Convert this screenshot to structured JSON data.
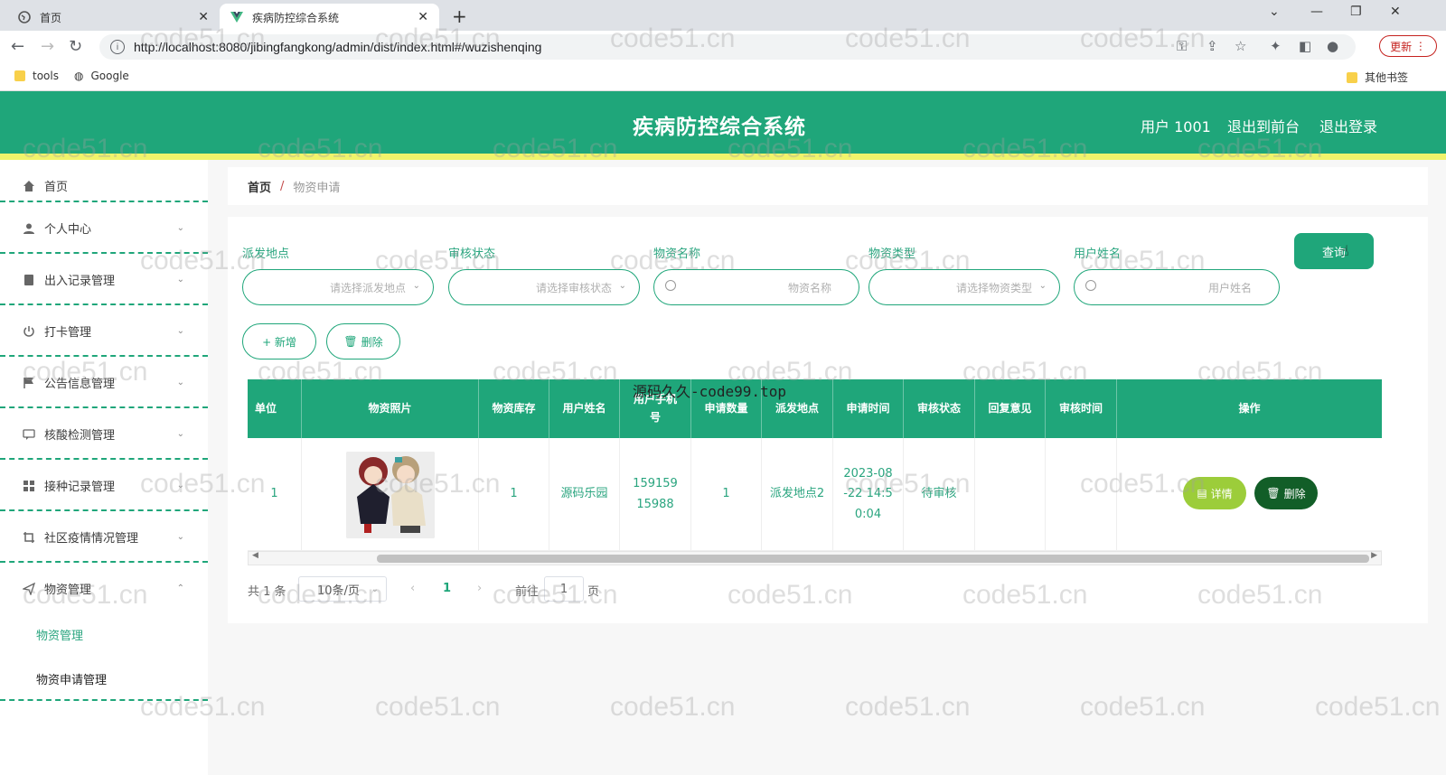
{
  "browser": {
    "tabs": [
      {
        "title": "首页",
        "active": false
      },
      {
        "title": "疾病防控综合系统",
        "active": true
      }
    ],
    "url": "http://localhost:8080/jibingfangkong/admin/dist/index.html#/wuzishenqing",
    "update_label": "更新",
    "bookmarks": [
      "tools",
      "Google"
    ],
    "other_bookmarks": "其他书签"
  },
  "header": {
    "title": "疾病防控综合系统",
    "user_label": "用户 1001",
    "front_label": "退出到前台",
    "logout_label": "退出登录",
    "bg_color": "#1fa67a"
  },
  "sidebar": {
    "items": [
      {
        "label": "首页",
        "icon": "home-icon"
      },
      {
        "label": "个人中心",
        "icon": "user-icon"
      },
      {
        "label": "出入记录管理",
        "icon": "document-icon"
      },
      {
        "label": "打卡管理",
        "icon": "power-icon"
      },
      {
        "label": "公告信息管理",
        "icon": "flag-icon"
      },
      {
        "label": "核酸检测管理",
        "icon": "chat-icon"
      },
      {
        "label": "接种记录管理",
        "icon": "grid-icon"
      },
      {
        "label": "社区疫情情况管理",
        "icon": "crop-icon"
      },
      {
        "label": "物资管理",
        "icon": "send-icon"
      }
    ],
    "sub_items": [
      "物资管理",
      "物资申请管理"
    ]
  },
  "breadcrumb": {
    "home": "首页",
    "separator": "/",
    "current": "物资申请"
  },
  "filters": {
    "dispatch_location": {
      "label": "派发地点",
      "placeholder": "请选择派发地点"
    },
    "audit_status": {
      "label": "审核状态",
      "placeholder": "请选择审核状态"
    },
    "material_name": {
      "label": "物资名称",
      "placeholder": "物资名称"
    },
    "material_type": {
      "label": "物资类型",
      "placeholder": "请选择物资类型"
    },
    "user_name": {
      "label": "用户姓名",
      "placeholder": "用户姓名"
    },
    "query_label": "查询"
  },
  "actions": {
    "add_label": "+ 新增",
    "delete_label": "删除"
  },
  "table": {
    "headers": [
      "单位",
      "物资照片",
      "物资库存",
      "用户姓名",
      "用户手机号",
      "申请数量",
      "派发地点",
      "申请时间",
      "审核状态",
      "回复意见",
      "审核时间",
      "操作"
    ],
    "rows": [
      {
        "unit": "1",
        "stock": "1",
        "user_name": "源码乐园",
        "phone": "15915915988",
        "quantity": "1",
        "location": "派发地点2",
        "apply_time": "2023-08-22 14:50:04",
        "status": "待审核",
        "reply": "",
        "audit_time": "",
        "detail_label": "详情",
        "delete_label": "删除"
      }
    ]
  },
  "pager": {
    "total": "共 1 条",
    "page_size": "10条/页",
    "current_page": "1",
    "goto_label": "前往",
    "goto_value": "1",
    "page_unit": "页"
  },
  "overlay_text": "源码久久-code99.top",
  "watermark": "code51.cn"
}
